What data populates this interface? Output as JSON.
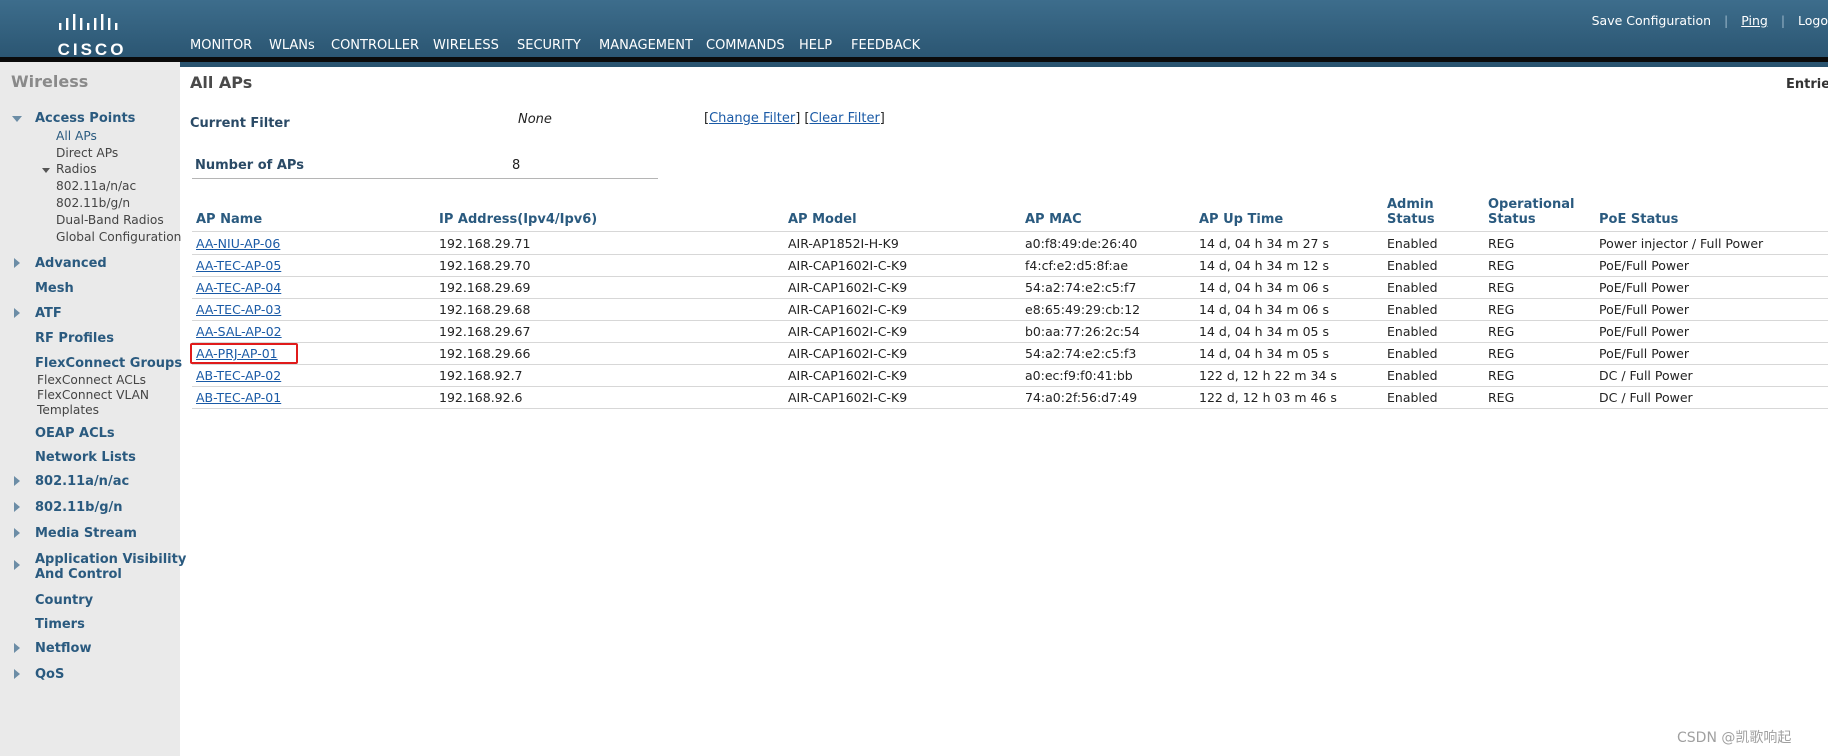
{
  "header": {
    "logo_text": "CISCO",
    "nav": [
      "MONITOR",
      "WLANs",
      "CONTROLLER",
      "WIRELESS",
      "SECURITY",
      "MANAGEMENT",
      "COMMANDS",
      "HELP",
      "FEEDBACK"
    ],
    "active_nav": "WIRELESS",
    "actions": {
      "save": "Save Configuration",
      "ping": "Ping",
      "logout": "Logo"
    },
    "colors": {
      "bar": "#3d6d8c",
      "active_underline": "#f5a623"
    }
  },
  "sidebar": {
    "title": "Wireless",
    "access_points": {
      "label": "Access Points",
      "items": [
        "All APs",
        "Direct APs"
      ],
      "radios": {
        "label": "Radios",
        "items": [
          "802.11a/n/ac",
          "802.11b/g/n",
          "Dual-Band Radios",
          "Global Configuration"
        ]
      }
    },
    "sections": [
      "Advanced",
      "Mesh",
      "ATF",
      "RF Profiles"
    ],
    "flexconnect": {
      "label": "FlexConnect Groups",
      "items": [
        "FlexConnect ACLs",
        "FlexConnect VLAN",
        "Templates"
      ]
    },
    "sections2": [
      "OEAP ACLs",
      "Network Lists",
      "802.11a/n/ac",
      "802.11b/g/n",
      "Media Stream"
    ],
    "avc": {
      "line1": "Application Visibility",
      "line2": "And Control"
    },
    "sections3": [
      "Country",
      "Timers",
      "Netflow",
      "QoS"
    ]
  },
  "main": {
    "title": "All APs",
    "entries_label": "Entries",
    "current_filter": {
      "label": "Current Filter",
      "value": "None",
      "change": "Change Filter",
      "clear": "Clear Filter"
    },
    "number_of_aps": {
      "label": "Number of APs",
      "value": "8"
    },
    "columns": {
      "ap_name": "AP Name",
      "ip": "IP Address(Ipv4/Ipv6)",
      "model": "AP Model",
      "mac": "AP MAC",
      "uptime": "AP Up Time",
      "admin": [
        "Admin",
        "Status"
      ],
      "oper": [
        "Operational",
        "Status"
      ],
      "poe": "PoE Status"
    },
    "rows": [
      {
        "name": "AA-NIU-AP-06",
        "ip": "192.168.29.71",
        "model": "AIR-AP1852I-H-K9",
        "mac": "a0:f8:49:de:26:40",
        "uptime": "14 d, 04 h 34 m 27 s",
        "admin": "Enabled",
        "oper": "REG",
        "poe": "Power injector / Full Power"
      },
      {
        "name": "AA-TEC-AP-05",
        "ip": "192.168.29.70",
        "model": "AIR-CAP1602I-C-K9",
        "mac": "f4:cf:e2:d5:8f:ae",
        "uptime": "14 d, 04 h 34 m 12 s",
        "admin": "Enabled",
        "oper": "REG",
        "poe": "PoE/Full Power"
      },
      {
        "name": "AA-TEC-AP-04",
        "ip": "192.168.29.69",
        "model": "AIR-CAP1602I-C-K9",
        "mac": "54:a2:74:e2:c5:f7",
        "uptime": "14 d, 04 h 34 m 06 s",
        "admin": "Enabled",
        "oper": "REG",
        "poe": "PoE/Full Power"
      },
      {
        "name": "AA-TEC-AP-03",
        "ip": "192.168.29.68",
        "model": "AIR-CAP1602I-C-K9",
        "mac": "e8:65:49:29:cb:12",
        "uptime": "14 d, 04 h 34 m 06 s",
        "admin": "Enabled",
        "oper": "REG",
        "poe": "PoE/Full Power"
      },
      {
        "name": "AA-SAL-AP-02",
        "ip": "192.168.29.67",
        "model": "AIR-CAP1602I-C-K9",
        "mac": "b0:aa:77:26:2c:54",
        "uptime": "14 d, 04 h 34 m 05 s",
        "admin": "Enabled",
        "oper": "REG",
        "poe": "PoE/Full Power"
      },
      {
        "name": "AA-PRJ-AP-01",
        "ip": "192.168.29.66",
        "model": "AIR-CAP1602I-C-K9",
        "mac": "54:a2:74:e2:c5:f3",
        "uptime": "14 d, 04 h 34 m 05 s",
        "admin": "Enabled",
        "oper": "REG",
        "poe": "PoE/Full Power"
      },
      {
        "name": "AB-TEC-AP-02",
        "ip": "192.168.92.7",
        "model": "AIR-CAP1602I-C-K9",
        "mac": "a0:ec:f9:f0:41:bb",
        "uptime": "122 d, 12 h 22 m 34 s",
        "admin": "Enabled",
        "oper": "REG",
        "poe": "DC / Full Power"
      },
      {
        "name": "AB-TEC-AP-01",
        "ip": "192.168.92.6",
        "model": "AIR-CAP1602I-C-K9",
        "mac": "74:a0:2f:56:d7:49",
        "uptime": "122 d, 12 h 03 m 46 s",
        "admin": "Enabled",
        "oper": "REG",
        "poe": "DC / Full Power"
      }
    ],
    "highlighted_row": "AA-PRJ-AP-01"
  },
  "watermark": "CSDN @凯歌响起"
}
